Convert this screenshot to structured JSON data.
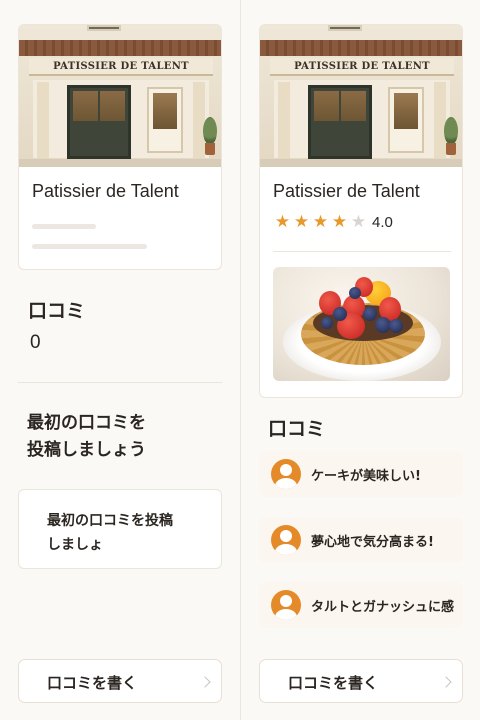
{
  "left_panel": {
    "shop": {
      "name": "Patissier de Talent",
      "sign_text": "PATISSIER DE TALENT",
      "image": "storefront-image"
    },
    "reviews_label": "口コミ",
    "review_count": "0",
    "empty_heading_line1": "最初の口コミを",
    "empty_heading_line2": "投稿しましょう",
    "post_card_line1": "最初の口コミを投稿",
    "post_card_line2": "しましょ",
    "write_button_label": "口コミを書く",
    "write_button_icon": "chevron-right-icon"
  },
  "right_panel": {
    "shop": {
      "name": "Patissier de Talent",
      "sign_text": "PATISSIER DE TALENT",
      "image": "storefront-image",
      "rating": 4.0,
      "rating_text": "4.0",
      "stars_filled": 4,
      "stars_total": 5,
      "photo": "fruit-tart-image"
    },
    "reviews_label": "口コミ",
    "reviews": [
      {
        "avatar": "user-avatar-icon",
        "text": "ケーキが美味しい!"
      },
      {
        "avatar": "user-avatar-icon",
        "text": "夢心地で気分高まる!"
      },
      {
        "avatar": "user-avatar-icon",
        "text": "タルトとガナッシュに感"
      }
    ],
    "write_button_label": "口コミを書く",
    "write_button_icon": "chevron-right-icon"
  },
  "colors": {
    "accent_star": "#e79a2b",
    "avatar": "#e58a28",
    "background": "#fbf9f5"
  }
}
